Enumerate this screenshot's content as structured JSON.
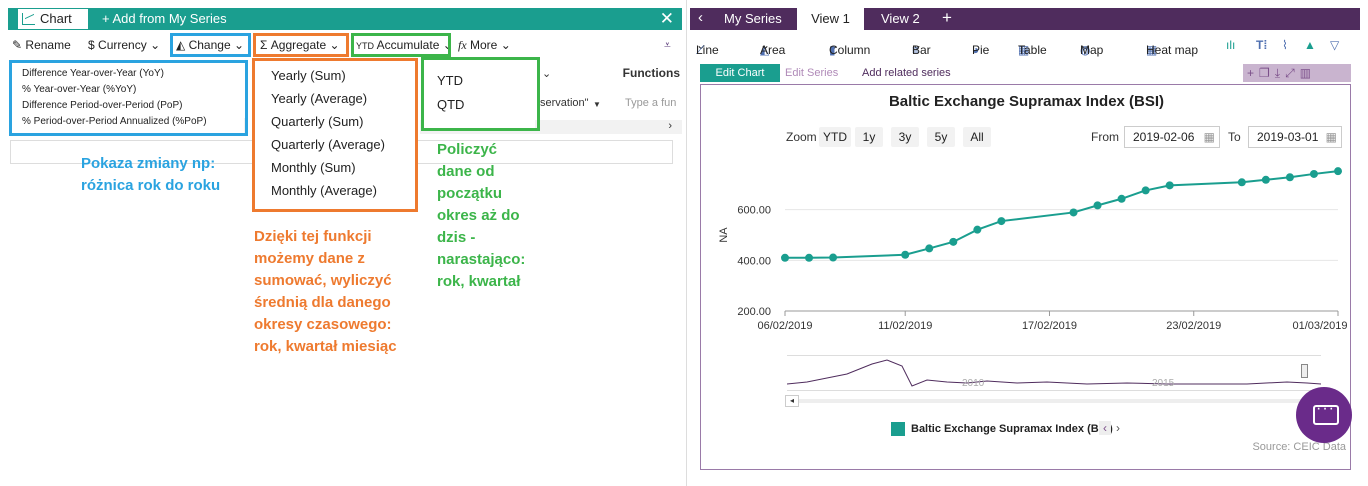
{
  "left": {
    "tab_label": "Chart",
    "add_series": "+ Add from My Series",
    "close_glyph": "✕",
    "toolbar": {
      "rename": "Rename",
      "currency": "Currency",
      "change": "Change",
      "aggregate": "Aggregate",
      "accumulate": "Accumulate",
      "more": "More",
      "functions": "Functions",
      "observation": "servation\"",
      "type_fun": "Type a fun"
    },
    "change_menu": [
      "Difference Year-over-Year (YoY)",
      "% Year-over-Year (%YoY)",
      "Difference Period-over-Period (PoP)",
      "% Period-over-Period Annualized (%PoP)"
    ],
    "aggregate_menu": [
      "Yearly (Sum)",
      "Yearly (Average)",
      "Quarterly (Sum)",
      "Quarterly (Average)",
      "Monthly (Sum)",
      "Monthly (Average)"
    ],
    "accumulate_menu": [
      "YTD",
      "QTD"
    ],
    "notes": {
      "blue": [
        "Pokaza zmiany np:",
        "różnica rok do roku"
      ],
      "orange": [
        "Dzięki tej funkcji",
        "możemy dane z",
        "sumować, wyliczyć",
        "średnią dla danego",
        "okresy czasowego:",
        "rok, kwartał miesiąc"
      ],
      "green": [
        "Policzyć",
        "dane od",
        "początku",
        "okres aż do",
        "dzis -",
        "narastająco:",
        "rok, kwartał"
      ]
    },
    "colors": {
      "teal": "#1a9e8f",
      "blue": "#2aa3e0",
      "orange": "#ee7a2f",
      "green": "#3cb54a"
    }
  },
  "right": {
    "tabs": {
      "my_series": "My Series",
      "view1": "View 1",
      "view2": "View 2",
      "add": "+"
    },
    "toolbar": {
      "line": "Line",
      "area": "Area",
      "column": "Column",
      "bar": "Bar",
      "pie": "Pie",
      "table": "Table",
      "map": "Map",
      "heatmap": "Heat map"
    },
    "subbar": {
      "edit_chart": "Edit Chart",
      "edit_series": "Edit Series",
      "add_related": "Add related series"
    },
    "zoom": {
      "label": "Zoom",
      "buttons": [
        "YTD",
        "1y",
        "3y",
        "5y",
        "All"
      ]
    },
    "range": {
      "from_label": "From",
      "from": "2019-02-06",
      "to_label": "To",
      "to": "2019-03-01"
    },
    "navigator": {
      "labels": [
        "2010",
        "2015"
      ]
    },
    "source": "Source: CEIC Data",
    "colors": {
      "purple": "#4f2c5d",
      "series": "#1a9e8f"
    }
  },
  "chart_data": {
    "type": "line",
    "title": "Baltic Exchange Supramax Index (BSI)",
    "ylabel": "NA",
    "xlabel": "",
    "x_ticks": [
      "06/02/2019",
      "11/02/2019",
      "17/02/2019",
      "23/02/2019",
      "01/03/2019"
    ],
    "y_ticks": [
      "200.00",
      "400.00",
      "600.00"
    ],
    "ylim": [
      200,
      800
    ],
    "grid": "horizontal",
    "legend": "bottom",
    "series": [
      {
        "name": "Baltic Exchange Supramax Index (BSI)",
        "x": [
          "2019-02-06",
          "2019-02-07",
          "2019-02-08",
          "2019-02-11",
          "2019-02-12",
          "2019-02-13",
          "2019-02-14",
          "2019-02-15",
          "2019-02-18",
          "2019-02-19",
          "2019-02-20",
          "2019-02-21",
          "2019-02-22",
          "2019-02-25",
          "2019-02-26",
          "2019-02-27",
          "2019-02-28",
          "2019-03-01"
        ],
        "values": [
          410,
          410,
          411,
          422,
          447,
          473,
          521,
          555,
          589,
          617,
          643,
          676,
          696,
          708,
          718,
          728,
          741,
          752
        ]
      }
    ]
  }
}
